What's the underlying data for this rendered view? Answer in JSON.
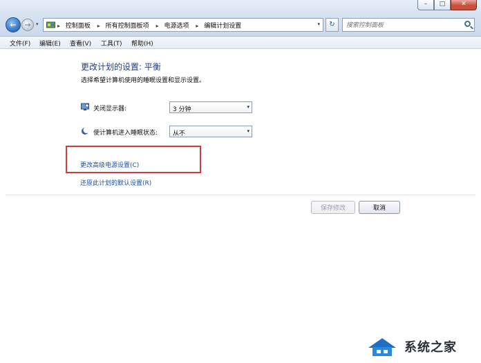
{
  "window": {
    "controls": {
      "minimize": "–",
      "maximize": "□",
      "close": "✕"
    }
  },
  "nav": {
    "back_icon": "←",
    "forward_icon": "→",
    "recent_icon": "▾",
    "breadcrumbs": [
      "控制面板",
      "所有控制面板项",
      "电源选项",
      "编辑计划设置"
    ],
    "separator": "▸",
    "address_dropdown": "▾",
    "refresh_icon": "↻",
    "search_placeholder": "搜索控制面板"
  },
  "menu": [
    "文件(F)",
    "编辑(E)",
    "查看(V)",
    "工具(T)",
    "帮助(H)"
  ],
  "page": {
    "title": "更改计划的设置: 平衡",
    "subtitle": "选择希望计算机使用的睡眠设置和显示设置。",
    "settings": [
      {
        "label": "关闭显示器:",
        "value": "3 分钟",
        "icon": "monitor-icon"
      },
      {
        "label": "使计算机进入睡眠状态:",
        "value": "从不",
        "icon": "moon-icon"
      }
    ],
    "advanced_link": "更改高级电源设置(C)",
    "restore_link": "还原此计划的默认设置(R)",
    "save_button": "保存修改",
    "cancel_button": "取消"
  },
  "watermark": {
    "text": "系统之家"
  },
  "colors": {
    "title_blue": "#1f3c88",
    "link_blue": "#1a4fa8",
    "highlight_red": "#d23b3b"
  }
}
